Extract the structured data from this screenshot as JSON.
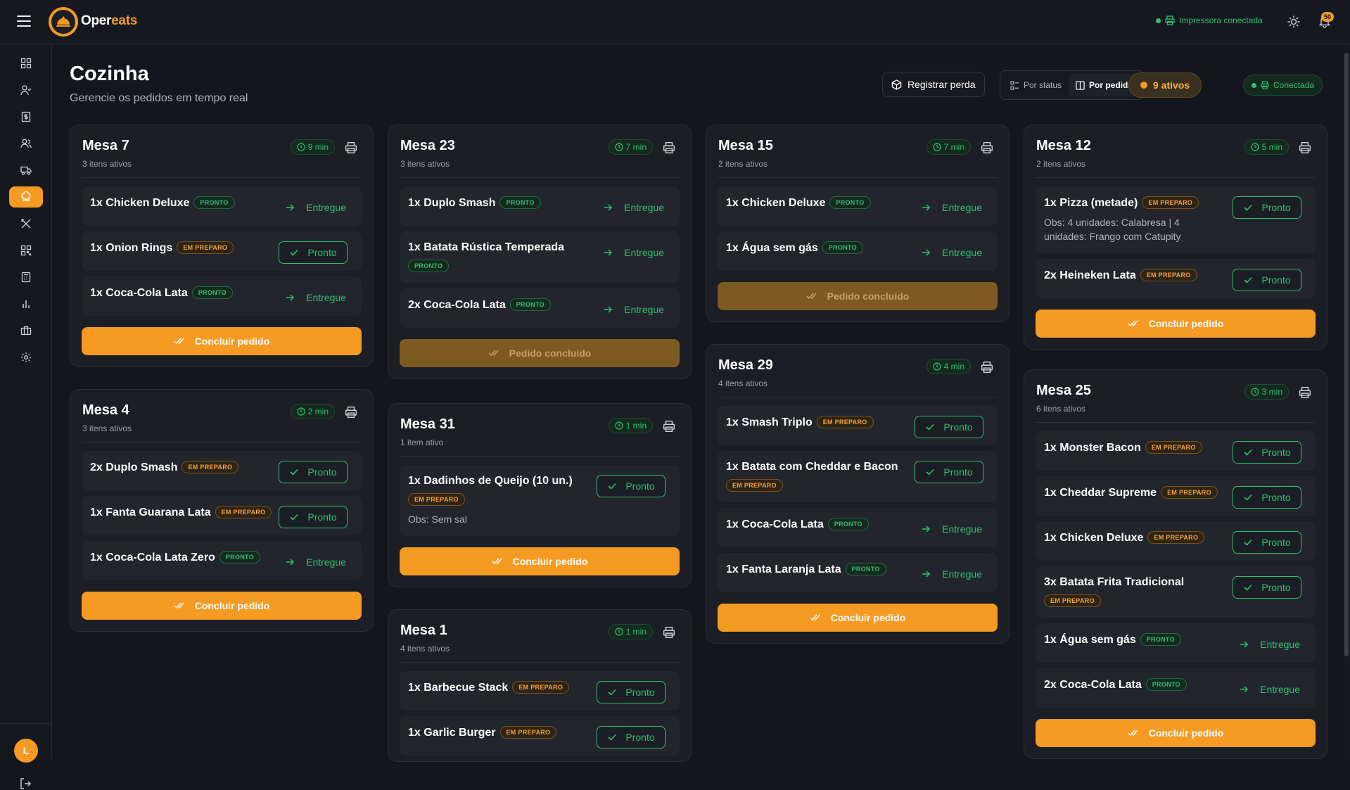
{
  "brand": {
    "prefix": "Oper",
    "suffix": "eats"
  },
  "header": {
    "printer_status": "Impressora conectada",
    "notifications": "50"
  },
  "user": {
    "initial": "L"
  },
  "page": {
    "title": "Cozinha",
    "subtitle": "Gerencie os pedidos em tempo real"
  },
  "toolbar": {
    "register_loss": "Registrar perda",
    "view_status": "Por status",
    "view_order": "Por pedido",
    "active_count": "9 ativos",
    "connection": "Conectada"
  },
  "labels": {
    "pronto_badge": "PRONTO",
    "prep_badge": "EM PREPARO",
    "pronto_btn": "Pronto",
    "entregue_btn": "Entregue",
    "concluir": "Concluir pedido",
    "concluido": "Pedido concluído"
  },
  "colors": {
    "accent": "#f59a23",
    "success": "#2fbf71",
    "background": "#13161c",
    "card": "#1b1e24"
  },
  "sidebar_icons": [
    "dashboard-icon",
    "user-check-icon",
    "receipt-icon",
    "users-icon",
    "delivery-truck-icon",
    "chef-hat-icon",
    "utensils-icon",
    "qr-code-icon",
    "calculator-icon",
    "bar-chart-icon",
    "store-icon",
    "gear-icon"
  ],
  "orders": {
    "mesa7": {
      "title": "Mesa 7",
      "sub": "3 itens ativos",
      "time": "9 min",
      "items": [
        {
          "name": "1x Chicken Deluxe",
          "status": "PRONTO"
        },
        {
          "name": "1x Onion Rings",
          "status": "EM PREPARO"
        },
        {
          "name": "1x Coca-Cola Lata",
          "status": "PRONTO"
        }
      ]
    },
    "mesa4": {
      "title": "Mesa 4",
      "sub": "3 itens ativos",
      "time": "2 min",
      "items": [
        {
          "name": "2x Duplo Smash",
          "status": "EM PREPARO"
        },
        {
          "name": "1x Fanta Guarana Lata",
          "status": "EM PREPARO"
        },
        {
          "name": "1x Coca-Cola Lata Zero",
          "status": "PRONTO"
        }
      ]
    },
    "mesa23": {
      "title": "Mesa 23",
      "sub": "3 itens ativos",
      "time": "7 min",
      "items": [
        {
          "name": "1x Duplo Smash",
          "status": "PRONTO"
        },
        {
          "name": "1x Batata Rústica Temperada",
          "status": "PRONTO"
        },
        {
          "name": "2x Coca-Cola Lata",
          "status": "PRONTO"
        }
      ]
    },
    "mesa31": {
      "title": "Mesa 31",
      "sub": "1 item ativo",
      "time": "1 min",
      "items": [
        {
          "name": "1x Dadinhos de Queijo (10 un.)",
          "status": "EM PREPARO",
          "obs": "Obs: Sem sal"
        }
      ]
    },
    "mesa1": {
      "title": "Mesa 1",
      "sub": "4 itens ativos",
      "time": "1 min",
      "items": [
        {
          "name": "1x Barbecue Stack",
          "status": "EM PREPARO"
        },
        {
          "name": "1x Garlic Burger",
          "status": "EM PREPARO"
        }
      ]
    },
    "mesa15": {
      "title": "Mesa 15",
      "sub": "2 itens ativos",
      "time": "7 min",
      "items": [
        {
          "name": "1x Chicken Deluxe",
          "status": "PRONTO"
        },
        {
          "name": "1x Água sem gás",
          "status": "PRONTO"
        }
      ]
    },
    "mesa29": {
      "title": "Mesa 29",
      "sub": "4 itens ativos",
      "time": "4 min",
      "items": [
        {
          "name": "1x Smash Triplo",
          "status": "EM PREPARO"
        },
        {
          "name": "1x Batata com Cheddar e Bacon",
          "status": "EM PREPARO"
        },
        {
          "name": "1x Coca-Cola Lata",
          "status": "PRONTO"
        },
        {
          "name": "1x Fanta Laranja Lata",
          "status": "PRONTO"
        }
      ]
    },
    "mesa12": {
      "title": "Mesa 12",
      "sub": "2 itens ativos",
      "time": "5 min",
      "items": [
        {
          "name": "1x Pizza (metade)",
          "status": "EM PREPARO",
          "obs": "Obs: 4 unidades: Calabresa | 4 unidades: Frango com Catupity"
        },
        {
          "name": "2x Heineken Lata",
          "status": "EM PREPARO"
        }
      ]
    },
    "mesa25": {
      "title": "Mesa 25",
      "sub": "6 itens ativos",
      "time": "3 min",
      "items": [
        {
          "name": "1x Monster Bacon",
          "status": "EM PREPARO"
        },
        {
          "name": "1x Cheddar Supreme",
          "status": "EM PREPARO"
        },
        {
          "name": "1x Chicken Deluxe",
          "status": "EM PREPARO"
        },
        {
          "name": "3x Batata Frita Tradicional",
          "status": "EM PREPARO"
        },
        {
          "name": "1x Água sem gás",
          "status": "PRONTO"
        },
        {
          "name": "2x Coca-Cola Lata",
          "status": "PRONTO"
        }
      ]
    }
  }
}
